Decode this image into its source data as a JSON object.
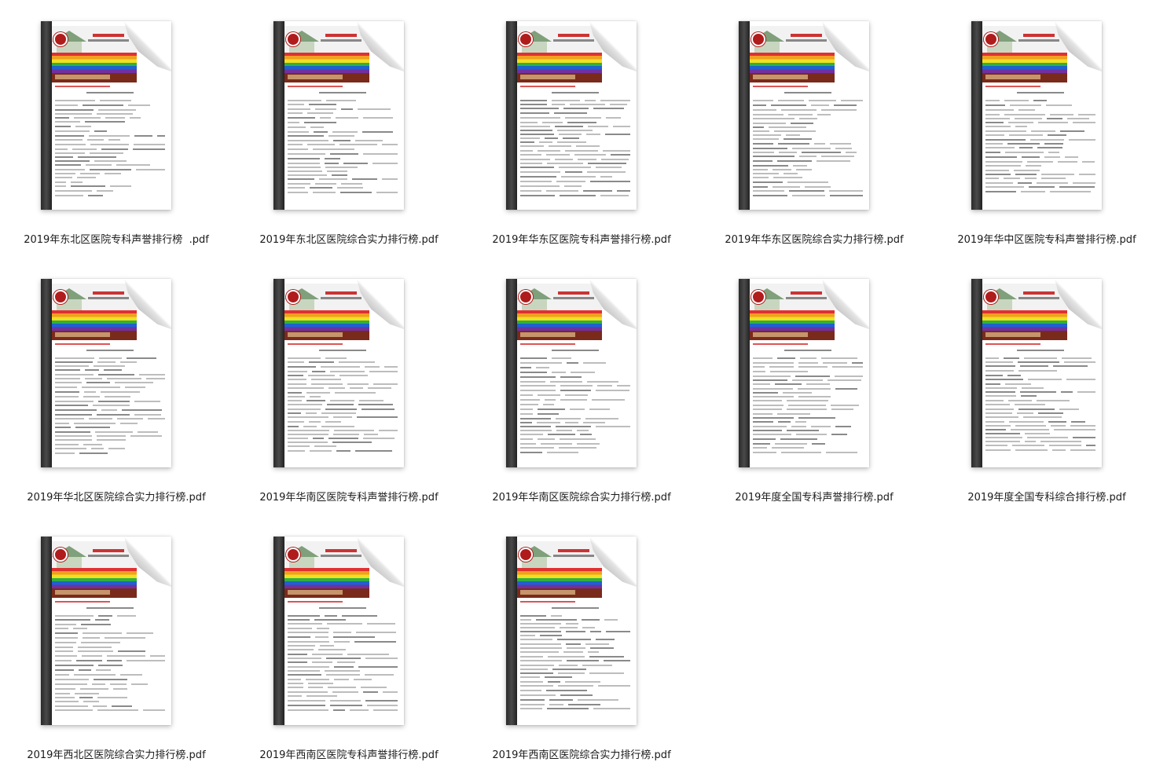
{
  "files": [
    {
      "name": "2019年东北区医院专科声誉排行榜  .pdf",
      "icon": "pdf-document-icon"
    },
    {
      "name": "2019年东北区医院综合实力排行榜.pdf",
      "icon": "pdf-document-icon"
    },
    {
      "name": "2019年华东区医院专科声誉排行榜.pdf",
      "icon": "pdf-document-icon"
    },
    {
      "name": "2019年华东区医院综合实力排行榜.pdf",
      "icon": "pdf-document-icon"
    },
    {
      "name": "2019年华中区医院专科声誉排行榜.pdf",
      "icon": "pdf-document-icon"
    },
    {
      "name": "2019年华北区医院综合实力排行榜.pdf",
      "icon": "pdf-document-icon"
    },
    {
      "name": "2019年华南区医院专科声誉排行榜.pdf",
      "icon": "pdf-document-icon"
    },
    {
      "name": "2019年华南区医院综合实力排行榜.pdf",
      "icon": "pdf-document-icon"
    },
    {
      "name": "2019年度全国专科声誉排行榜.pdf",
      "icon": "pdf-document-icon"
    },
    {
      "name": "2019年度全国专科综合排行榜.pdf",
      "icon": "pdf-document-icon"
    },
    {
      "name": "2019年西北区医院综合实力排行榜.pdf",
      "icon": "pdf-document-icon"
    },
    {
      "name": "2019年西南区医院专科声誉排行榜.pdf",
      "icon": "pdf-document-icon"
    },
    {
      "name": "2019年西南区医院综合实力排行榜.pdf",
      "icon": "pdf-document-icon"
    }
  ]
}
